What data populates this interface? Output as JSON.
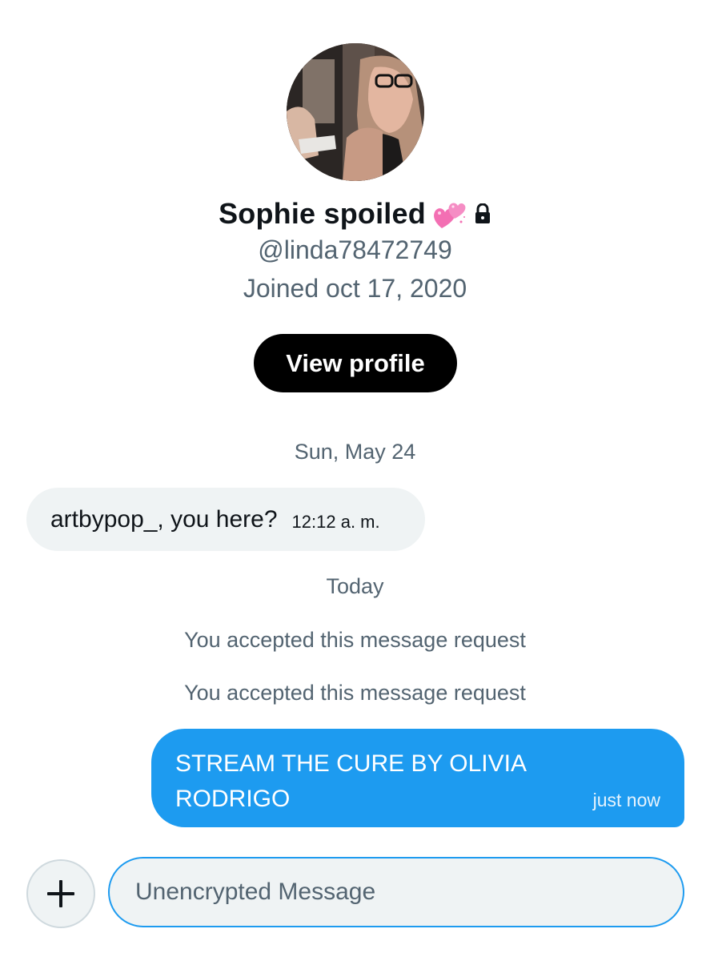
{
  "profile": {
    "display_name": "Sophie spoiled",
    "name_emoji": "two-hearts-emoji",
    "protected_icon": "lock-icon",
    "handle": "@linda78472749",
    "joined": "Joined oct 17, 2020",
    "view_profile_label": "View profile"
  },
  "conversation": {
    "date_separators": [
      "Sun, May 24",
      "Today"
    ],
    "incoming_message": {
      "text": "artbypop_, you here?",
      "time": "12:12 a. m."
    },
    "system_notes": [
      "You accepted this message request",
      "You accepted this message request"
    ],
    "outgoing_message": {
      "text": "STREAM THE CURE BY OLIVIA RODRIGO",
      "time": "just now"
    }
  },
  "composer": {
    "add_icon": "plus-icon",
    "placeholder": "Unencrypted Message"
  },
  "colors": {
    "accent": "#1d9bf0",
    "text_primary": "#0f1419",
    "text_secondary": "#536471",
    "bubble_incoming": "#eff3f4",
    "button_dark": "#000000"
  }
}
